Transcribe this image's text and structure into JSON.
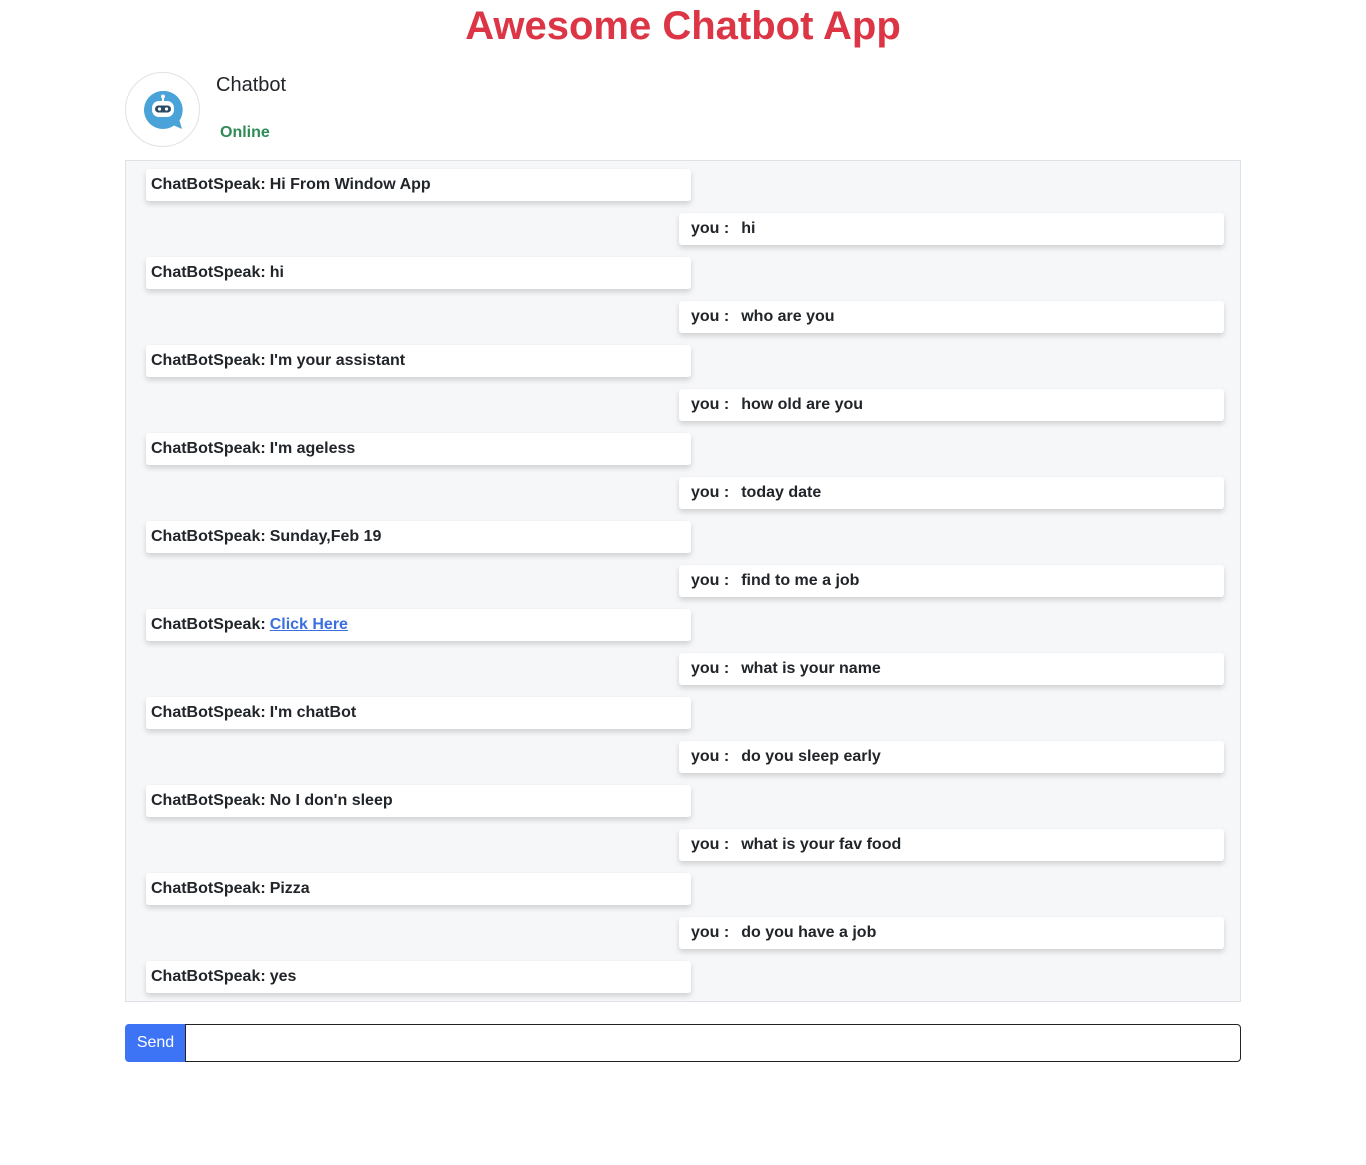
{
  "app": {
    "title": "Awesome Chatbot App"
  },
  "header": {
    "bot_name": "Chatbot",
    "status": "Online",
    "avatar_icon": "chatbot-robot-icon",
    "colors": {
      "title": "#dc3545",
      "status": "#2e8b57",
      "avatar_bubble": "#4aa3d8",
      "send_button": "#3d74f5",
      "link": "#3b6fe0"
    }
  },
  "messages": [
    {
      "sender": "bot",
      "prefix": "ChatBotSpeak:",
      "text": "Hi From Window App"
    },
    {
      "sender": "user",
      "prefix": "you :",
      "text": "hi"
    },
    {
      "sender": "bot",
      "prefix": "ChatBotSpeak:",
      "text": "hi"
    },
    {
      "sender": "user",
      "prefix": "you :",
      "text": "who are you"
    },
    {
      "sender": "bot",
      "prefix": "ChatBotSpeak:",
      "text": "I'm your assistant"
    },
    {
      "sender": "user",
      "prefix": "you :",
      "text": "how old are you"
    },
    {
      "sender": "bot",
      "prefix": "ChatBotSpeak:",
      "text": "I'm ageless"
    },
    {
      "sender": "user",
      "prefix": "you :",
      "text": "today date"
    },
    {
      "sender": "bot",
      "prefix": "ChatBotSpeak:",
      "text": "Sunday,Feb 19"
    },
    {
      "sender": "user",
      "prefix": "you :",
      "text": "find to me a job"
    },
    {
      "sender": "bot",
      "prefix": "ChatBotSpeak:",
      "link_text": "Click Here"
    },
    {
      "sender": "user",
      "prefix": "you :",
      "text": "what is your name"
    },
    {
      "sender": "bot",
      "prefix": "ChatBotSpeak:",
      "text": "I'm chatBot"
    },
    {
      "sender": "user",
      "prefix": "you :",
      "text": "do you sleep early"
    },
    {
      "sender": "bot",
      "prefix": "ChatBotSpeak:",
      "text": "No I don'n sleep"
    },
    {
      "sender": "user",
      "prefix": "you :",
      "text": "what is your fav food"
    },
    {
      "sender": "bot",
      "prefix": "ChatBotSpeak:",
      "text": "Pizza"
    },
    {
      "sender": "user",
      "prefix": "you :",
      "text": "do you have a job"
    },
    {
      "sender": "bot",
      "prefix": "ChatBotSpeak:",
      "text": "yes"
    }
  ],
  "composer": {
    "send_label": "Send",
    "input_value": "",
    "placeholder": ""
  }
}
